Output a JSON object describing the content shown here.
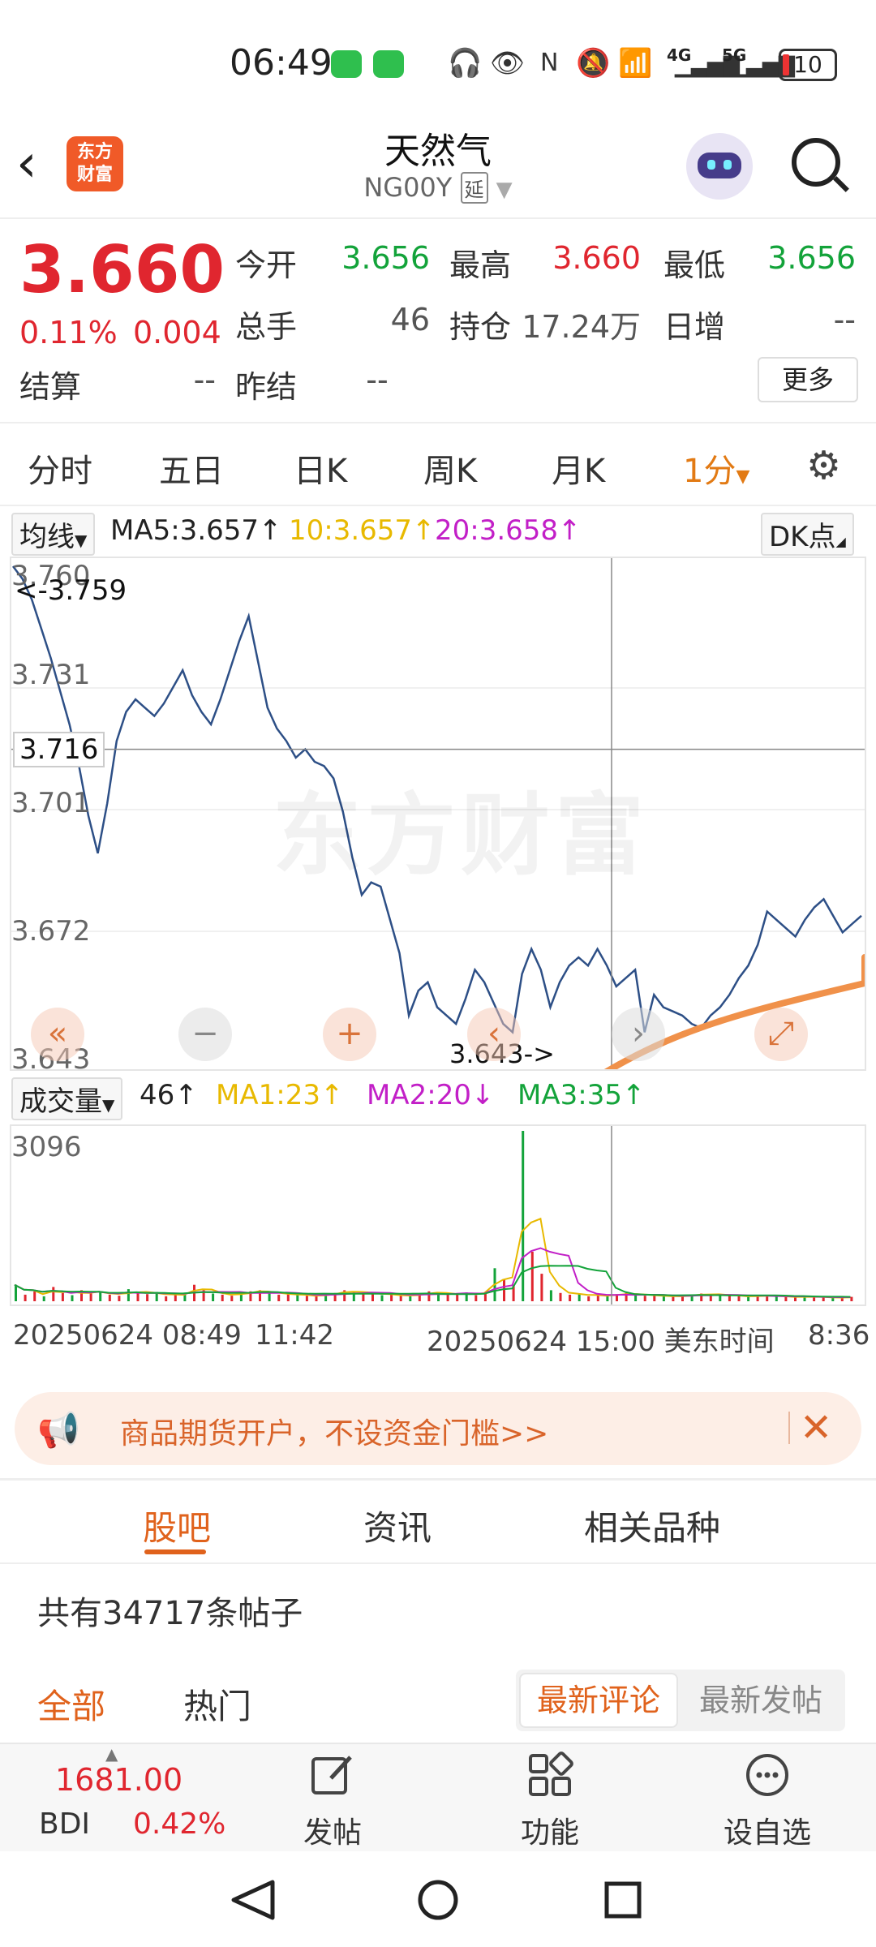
{
  "status_bar": {
    "time": "06:49",
    "network": "4G",
    "network2": "5G",
    "battery": "10"
  },
  "header": {
    "title": "天然气",
    "code": "NG00Y",
    "delay_tag": "延"
  },
  "quote": {
    "price": "3.660",
    "change_pct": "0.11%",
    "change": "0.004",
    "fields": [
      {
        "label": "今开",
        "value": "3.656",
        "color": "green"
      },
      {
        "label": "最高",
        "value": "3.660",
        "color": "red"
      },
      {
        "label": "最低",
        "value": "3.656",
        "color": "green"
      },
      {
        "label": "总手",
        "value": "46",
        "color": "gray"
      },
      {
        "label": "持仓",
        "value": "17.24万",
        "color": "gray"
      },
      {
        "label": "日增",
        "value": "--",
        "color": "gray"
      },
      {
        "label": "结算",
        "value": "--",
        "color": "gray"
      },
      {
        "label": "昨结",
        "value": "--",
        "color": "gray"
      }
    ],
    "more": "更多"
  },
  "period_tabs": [
    "分时",
    "五日",
    "日K",
    "周K",
    "月K",
    "1分"
  ],
  "ma": {
    "selector": "均线",
    "ma5": "MA5:3.657↑",
    "ma10": "10:3.657↑",
    "ma20": "20:3.658↑",
    "dk": "DK点"
  },
  "chart_data": {
    "type": "line",
    "y_ticks": [
      "3.760",
      "3.731",
      "3.701",
      "3.672",
      "3.643"
    ],
    "ylim": [
      3.643,
      3.76
    ],
    "high_label": "<-3.759",
    "low_label": "3.643->",
    "crosshair_value": "3.716",
    "values": [
      3.76,
      3.757,
      3.752,
      3.745,
      3.738,
      3.73,
      3.722,
      3.712,
      3.7,
      3.691,
      3.703,
      3.718,
      3.725,
      3.728,
      3.726,
      3.724,
      3.727,
      3.731,
      3.735,
      3.729,
      3.725,
      3.722,
      3.728,
      3.735,
      3.742,
      3.748,
      3.737,
      3.726,
      3.721,
      3.718,
      3.714,
      3.716,
      3.713,
      3.712,
      3.709,
      3.701,
      3.69,
      3.681,
      3.684,
      3.683,
      3.675,
      3.667,
      3.652,
      3.658,
      3.66,
      3.654,
      3.652,
      3.65,
      3.656,
      3.663,
      3.66,
      3.655,
      3.65,
      3.648,
      3.662,
      3.668,
      3.663,
      3.654,
      3.66,
      3.664,
      3.666,
      3.664,
      3.668,
      3.664,
      3.659,
      3.661,
      3.663,
      3.648,
      3.657,
      3.654,
      3.653,
      3.652,
      3.65,
      3.649,
      3.652,
      3.654,
      3.657,
      3.661,
      3.664,
      3.669,
      3.677,
      3.675,
      3.673,
      3.671,
      3.675,
      3.678,
      3.68,
      3.676,
      3.672,
      3.674,
      3.676
    ],
    "ma_lines": [
      {
        "name": "MA1",
        "value": "23",
        "color": "#e8b900"
      },
      {
        "name": "MA2",
        "value": "20",
        "color": "#c21fc7"
      },
      {
        "name": "MA3",
        "value": "35",
        "color": "#13a33a"
      }
    ],
    "volume_max": "3096",
    "volume_current": "46↑",
    "volume_selector": "成交量",
    "volume_values": [
      300,
      120,
      180,
      90,
      260,
      150,
      110,
      200,
      140,
      180,
      120,
      100,
      220,
      160,
      130,
      170,
      90,
      110,
      150,
      300,
      200,
      140,
      120,
      100,
      160,
      180,
      200,
      150,
      120,
      140,
      110,
      100,
      90,
      130,
      150,
      200,
      170,
      140,
      160,
      110,
      120,
      100,
      90,
      140,
      180,
      150,
      120,
      130,
      160,
      110,
      170,
      600,
      400,
      300,
      3096,
      900,
      500,
      200,
      150,
      120,
      140,
      90,
      110,
      100,
      130,
      150,
      120,
      100,
      110,
      90,
      80,
      100,
      120,
      140,
      110,
      130,
      100,
      90,
      80,
      110,
      100,
      90,
      80,
      70,
      90,
      80,
      70,
      60,
      70,
      80
    ],
    "x_labels": [
      "20250624 08:49",
      "11:42",
      "20250624 15:00 美东时间",
      "8:36"
    ]
  },
  "controls": {
    "zoom_out": "−",
    "zoom_in": "+"
  },
  "banner": {
    "text": "商品期货开户，不设资金门槛>>"
  },
  "content_tabs": [
    "股吧",
    "资讯",
    "相关品种"
  ],
  "posts": {
    "count_text": "共有34717条帖子"
  },
  "filter_tabs": [
    "全部",
    "热门"
  ],
  "sort": {
    "latest_comment": "最新评论",
    "latest_post": "最新发帖"
  },
  "bottom": {
    "bdi_value": "1681.00",
    "bdi_label": "BDI",
    "bdi_pct": "0.42%",
    "post": "发帖",
    "function": "功能",
    "watchlist": "设自选"
  },
  "colors": {
    "up": "#e0262f",
    "down": "#13a33a",
    "accent": "#e0621c",
    "line": "#2d4f86"
  }
}
